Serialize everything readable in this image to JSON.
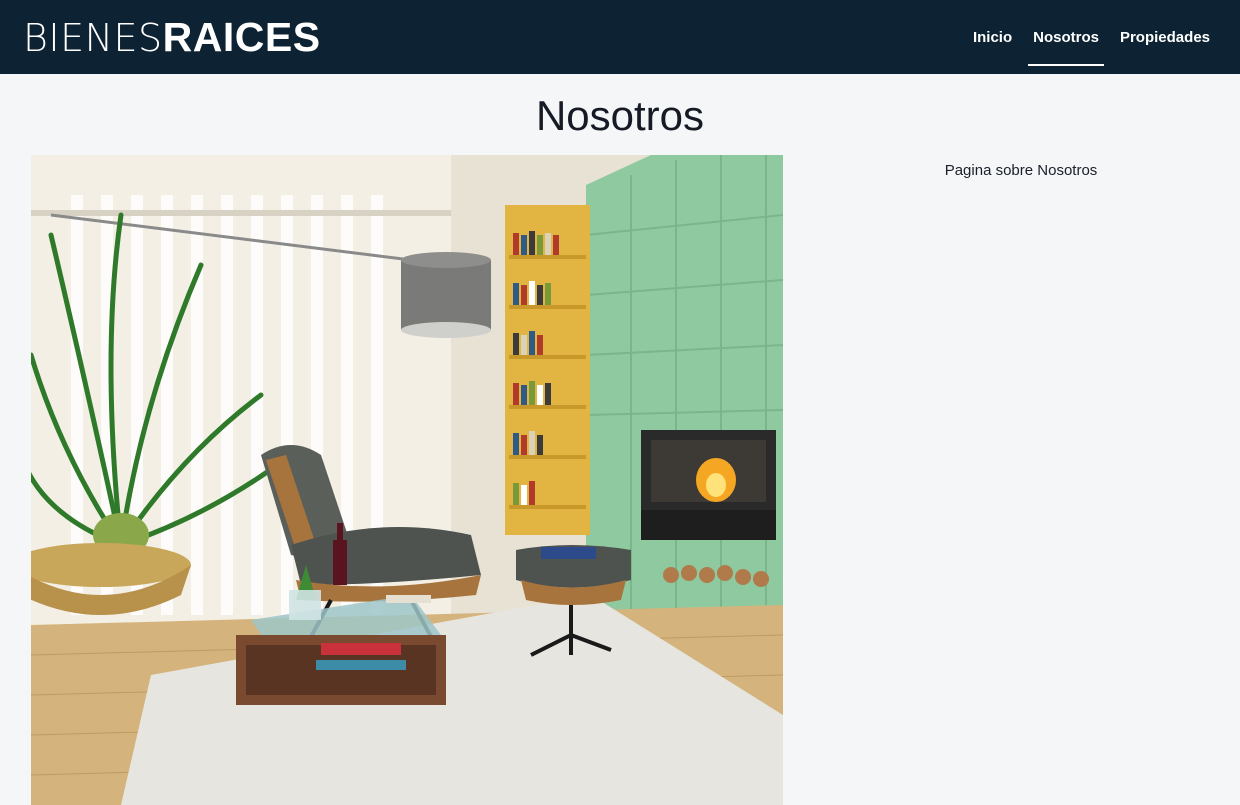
{
  "header": {
    "logo_light": "BIENES",
    "logo_bold": "RAICES",
    "background_color": "#0d2333"
  },
  "nav": {
    "items": [
      {
        "label": "Inicio",
        "active": false
      },
      {
        "label": "Nosotros",
        "active": true
      },
      {
        "label": "Propiedades",
        "active": false
      }
    ]
  },
  "main": {
    "title": "Nosotros",
    "image": {
      "alt": "living-room-interior",
      "icon": "interior-photo"
    },
    "text": "Pagina sobre Nosotros"
  },
  "colors": {
    "page_background": "#f5f6f8",
    "nav_text": "#ffffff"
  }
}
